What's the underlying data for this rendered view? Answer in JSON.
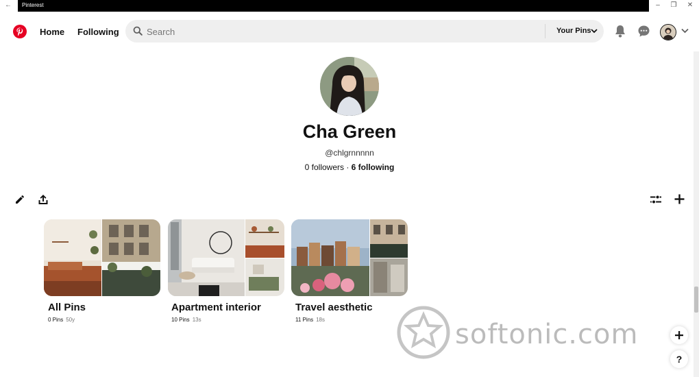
{
  "window": {
    "title": "Pinterest"
  },
  "header": {
    "nav": {
      "home": "Home",
      "following": "Following"
    },
    "search_placeholder": "Search",
    "your_pins": "Your Pins"
  },
  "profile": {
    "name": "Cha Green",
    "handle": "@chlgrnnnnn",
    "followers": "0 followers",
    "separator": " · ",
    "following": "6 following"
  },
  "boards": [
    {
      "title": "All Pins",
      "pins": "0 Pins",
      "age": "50y"
    },
    {
      "title": "Apartment interior",
      "pins": "10 Pins",
      "age": "13s"
    },
    {
      "title": "Travel aesthetic",
      "pins": "11 Pins",
      "age": "18s"
    }
  ],
  "watermark": {
    "text": "softonic.com"
  },
  "colors": {
    "brand": "#e60023",
    "search_bg": "#efefef",
    "text": "#111111"
  },
  "icons": [
    "pinterest-logo-icon",
    "search-icon",
    "chevron-down-icon",
    "bell-icon",
    "chat-icon",
    "pencil-icon",
    "share-icon",
    "filter-icon",
    "plus-icon",
    "help-icon"
  ]
}
